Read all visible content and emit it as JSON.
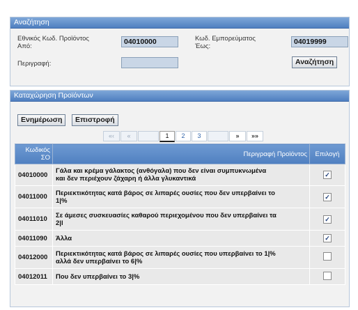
{
  "search": {
    "header": "Αναζήτηση",
    "code_from_label_1": "Εθνικός Κωδ. Προϊόντος",
    "code_from_label_2": "Από:",
    "code_from_value": "04010000",
    "code_to_label_1": "Κωδ. Εμπορεύματος",
    "code_to_label_2": "Έως:",
    "code_to_value": "04019999",
    "description_label": "Περιγραφή:",
    "description_value": "",
    "search_button": "Αναζήτηση"
  },
  "products": {
    "header": "Καταχώρηση Προϊόντων",
    "update_button": "Ενημέρωση",
    "back_button": "Επιστροφή",
    "pager": {
      "first": "«‹",
      "prev": "«",
      "pages": [
        "1",
        "2",
        "3"
      ],
      "next": "»",
      "last": "»»"
    },
    "columns": {
      "code_1": "Κωδικός",
      "code_2": "ΣΟ",
      "description": "Περιγραφή Προϊόντος",
      "select": "Επιλογή"
    },
    "rows": [
      {
        "code": "04010000",
        "desc_1": "Γάλα και κρέμα γάλακτος (ανθόγαλα) που δεν είναι συμπυκνωμένα",
        "desc_2": "και δεν περιέχουν ζάχαρη ή άλλα γλυκαντικά",
        "checked": "✓"
      },
      {
        "code": "04011000",
        "desc_1": "Περιεκτικότητας κατά βάρος σε λιπαρές ουσίες που δεν υπερβαίνει το",
        "desc_2": "1|%",
        "checked": "✓"
      },
      {
        "code": "04011010",
        "desc_1": "Σε άμεσες συσκευασίες καθαρού περιεχομένου που δεν υπερβαίνει τα",
        "desc_2": "2|l",
        "checked": "✓"
      },
      {
        "code": "04011090",
        "desc_1": "Άλλα",
        "desc_2": "",
        "checked": "✓"
      },
      {
        "code": "04012000",
        "desc_1": "Περιεκτικότητας κατά βάρος σε λιπαρές ουσίες που υπερβαίνει το 1|%",
        "desc_2": "αλλά δεν υπερβαίνει το 6|%",
        "checked": ""
      },
      {
        "code": "04012011",
        "desc_1": "Που δεν υπερβαίνει το 3|%",
        "desc_2": "",
        "checked": ""
      }
    ]
  }
}
